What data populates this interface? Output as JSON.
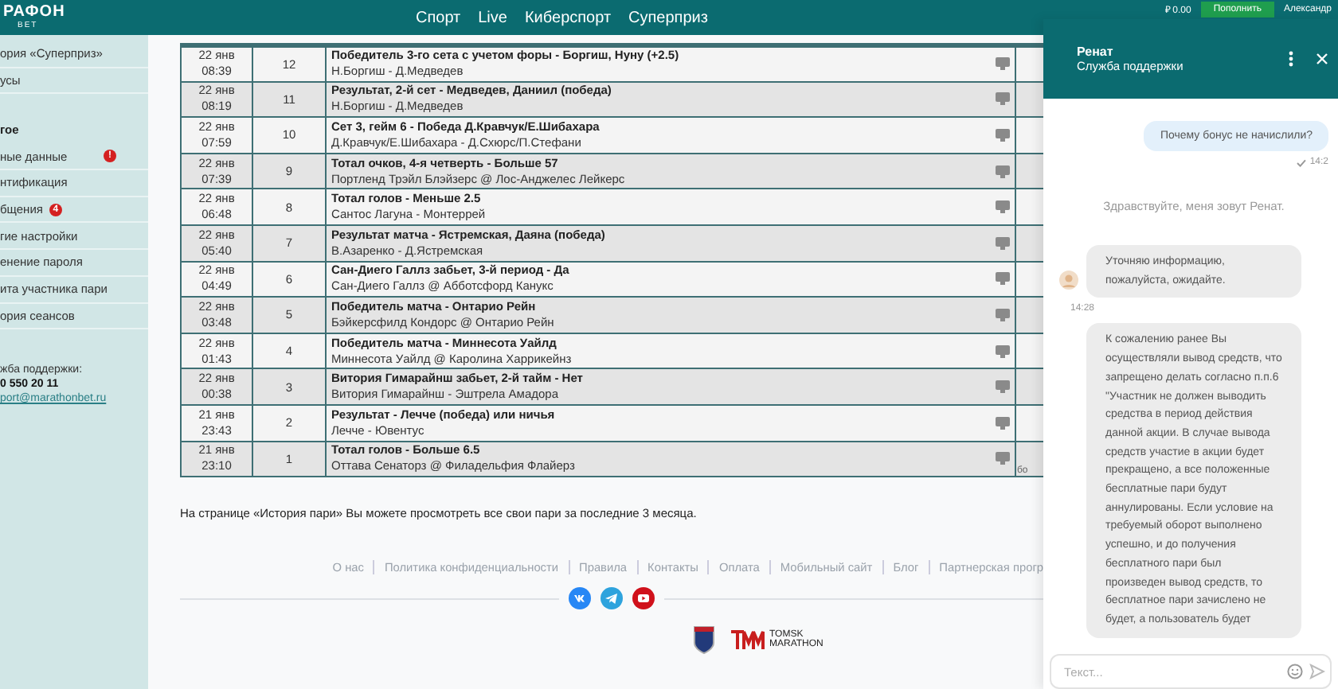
{
  "topbar": {
    "logo": {
      "main": "РАФОН",
      "sub": "BET"
    },
    "nav": [
      "Спорт",
      "Live",
      "Киберспорт",
      "Суперприз"
    ],
    "balance": "₽ 0.00",
    "deposit_button": "Пополнить",
    "user": "Александр"
  },
  "sidebar": {
    "groups": [
      {
        "items": [
          {
            "label": "ория «Суперприз»"
          },
          {
            "label": "усы"
          }
        ]
      },
      {
        "heading": "гое",
        "items": [
          {
            "label": "ные данные",
            "badge": "!"
          },
          {
            "label": "нтификация"
          },
          {
            "label": "бщения",
            "badge": "4"
          },
          {
            "label": "гие настройки"
          },
          {
            "label": "енение пароля"
          },
          {
            "label": "ита участника пари"
          },
          {
            "label": "ория сеансов"
          }
        ]
      }
    ],
    "support": {
      "label": "жба поддержки:",
      "phone": "0 550 20 11",
      "email": "port@marathonbet.ru"
    }
  },
  "table": {
    "rows": [
      {
        "date": "22 янв",
        "time": "08:39",
        "number": "12",
        "title": "Победитель 3-го сета с учетом форы - Боргиш, Нуну (+2.5)",
        "event": "Н.Боргиш - Д.Медведев"
      },
      {
        "date": "22 янв",
        "time": "08:19",
        "number": "11",
        "title": "Результат, 2-й сет - Медведев, Даниил (победа)",
        "event": "Н.Боргиш - Д.Медведев"
      },
      {
        "date": "22 янв",
        "time": "07:59",
        "number": "10",
        "title": "Сет 3, гейм 6 - Победа Д.Кравчук/Е.Шибахара",
        "event": "Д.Кравчук/Е.Шибахара - Д.Схюрс/П.Стефани"
      },
      {
        "date": "22 янв",
        "time": "07:39",
        "number": "9",
        "title": "Тотал очков, 4-я четверть - Больше 57",
        "event": "Портленд Трэйл Блэйзерс @ Лос-Анджелес Лейкерс"
      },
      {
        "date": "22 янв",
        "time": "06:48",
        "number": "8",
        "title": "Тотал голов - Меньше 2.5",
        "event": "Сантос Лагуна - Монтеррей"
      },
      {
        "date": "22 янв",
        "time": "05:40",
        "number": "7",
        "title": "Результат матча - Ястремская, Даяна (победа)",
        "event": "В.Азаренко - Д.Ястремская"
      },
      {
        "date": "22 янв",
        "time": "04:49",
        "number": "6",
        "title": "Сан-Диего Галлз забьет, 3-й период - Да",
        "event": "Сан-Диего Галлз @ Абботсфорд Канукс"
      },
      {
        "date": "22 янв",
        "time": "03:48",
        "number": "5",
        "title": "Победитель матча - Онтарио Рейн",
        "event": "Бэйкерсфилд Кондорс @ Онтарио Рейн"
      },
      {
        "date": "22 янв",
        "time": "01:43",
        "number": "4",
        "title": "Победитель матча - Миннесота Уайлд",
        "event": "Миннесота Уайлд @ Каролина Харрикейнз"
      },
      {
        "date": "22 янв",
        "time": "00:38",
        "number": "3",
        "title": "Витория Гимарайнш забьет, 2-й тайм - Нет",
        "event": "Витория Гимарайнш - Эштрела Амадора"
      },
      {
        "date": "21 янв",
        "time": "23:43",
        "number": "2",
        "title": "Результат - Лечче (победа) или ничья",
        "event": "Лечче - Ювентус"
      },
      {
        "date": "21 янв",
        "time": "23:10",
        "number": "1",
        "title": "Тотал голов - Больше 6.5",
        "event": "Оттава Сенаторз @ Филадельфия Флайерз",
        "column_5": "бо"
      }
    ]
  },
  "note": "На странице «История пари» Вы можете просмотреть все свои пари за последние 3 месяца.",
  "footer": {
    "links": [
      "О нас",
      "Политика конфиденциальности",
      "Правила",
      "Контакты",
      "Оплата",
      "Мобильный сайт",
      "Блог",
      "Партнерская прогр"
    ],
    "partner_logo": {
      "top": "TOMSK",
      "bottom": "MARATHON"
    }
  },
  "chat": {
    "agent": "Ренат",
    "role": "Служба поддержки",
    "messages": [
      {
        "kind": "outgoing",
        "text": "Почему бонус не начислили?",
        "time": "14:2"
      },
      {
        "kind": "system",
        "text": "Здравствуйте, меня зовут Ренат."
      },
      {
        "kind": "incoming",
        "text": "Уточняю информацию, пожалуйста, ожидайте.",
        "time": "14:28"
      },
      {
        "kind": "incoming",
        "text": "К сожалению ранее Вы осуществляли вывод средств, что запрещено делать согласно п.п.6 \"Участник не должен выводить средства в период действия данной акции. В случае вывода средств участие в акции будет прекращено, а все положенные бесплатные пари будут аннулированы. Если условие на требуемый оборот выполнено успешно, и до получения бесплатного пари был произведен вывод средств, то бесплатное пари зачислено не будет, а пользователь будет"
      }
    ],
    "input_placeholder": "Текст..."
  }
}
